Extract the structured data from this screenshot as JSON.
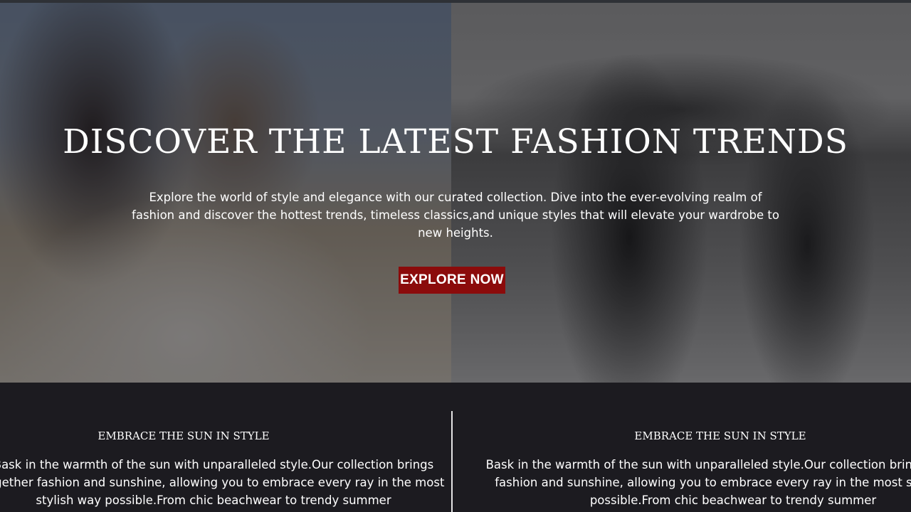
{
  "hero": {
    "title": "DISCOVER THE LATEST FASHION TRENDS",
    "description": "Explore the world of style and elegance with our curated collection. Dive into the ever-evolving realm of fashion and discover the hottest trends, timeless classics,and unique styles that will elevate your wardrobe to new heights.",
    "button_label": "EXPLORE NOW",
    "button_color": "#8b0b0b"
  },
  "features": [
    {
      "title": "EMBRACE THE SUN IN STYLE",
      "text": "Bask in the warmth of the sun with unparalleled style.Our collection brings together fashion and sunshine, allowing you to embrace every ray in the most stylish way possible.From chic beachwear to trendy summer"
    },
    {
      "title": "EMBRACE THE SUN IN STYLE",
      "text": "Bask in the warmth of the sun with unparalleled style.Our collection brings together fashion and sunshine, allowing you to embrace every ray in the most stylish way possible.From chic beachwear to trendy summer"
    }
  ]
}
